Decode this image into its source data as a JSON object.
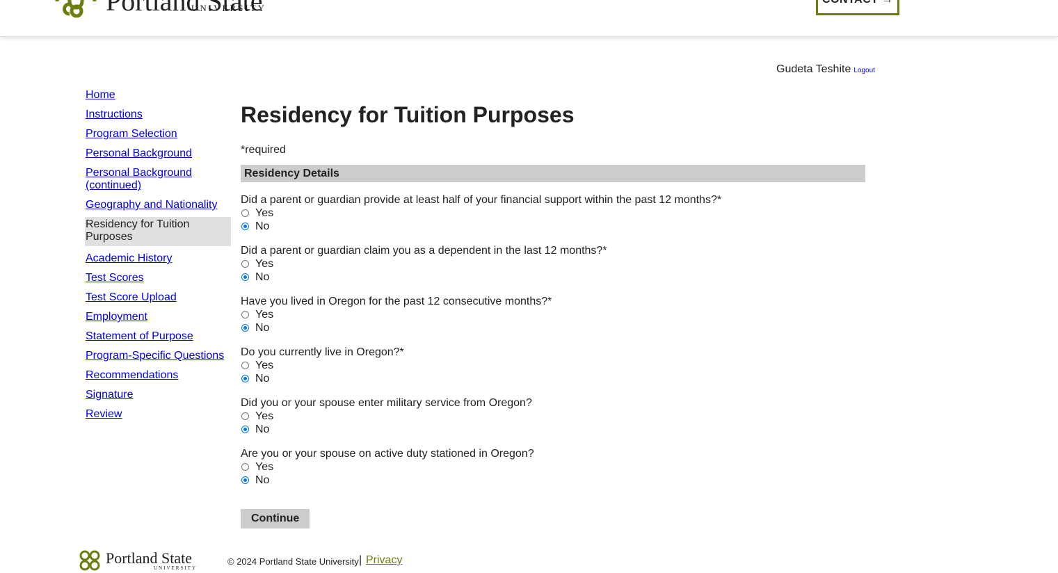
{
  "header": {
    "logo_text": "Portland State",
    "logo_subtext": "UNIVERSITY",
    "contact_label": "CONTACT →"
  },
  "user": {
    "name": "Gudeta Teshite",
    "logout_label": "Logout"
  },
  "sidebar": {
    "items": [
      {
        "label": "Home",
        "current": false
      },
      {
        "label": "Instructions",
        "current": false
      },
      {
        "label": "Program Selection",
        "current": false
      },
      {
        "label": "Personal Background",
        "current": false
      },
      {
        "label": "Personal Background (continued)",
        "current": false
      },
      {
        "label": "Geography and Nationality",
        "current": false
      },
      {
        "label": "Residency for Tuition Purposes",
        "current": true
      },
      {
        "label": "Academic History",
        "current": false
      },
      {
        "label": "Test Scores",
        "current": false
      },
      {
        "label": "Test Score Upload",
        "current": false
      },
      {
        "label": "Employment",
        "current": false
      },
      {
        "label": "Statement of Purpose",
        "current": false
      },
      {
        "label": "Program-Specific Questions",
        "current": false
      },
      {
        "label": "Recommendations",
        "current": false
      },
      {
        "label": "Signature",
        "current": false
      },
      {
        "label": "Review",
        "current": false
      }
    ]
  },
  "main": {
    "title": "Residency for Tuition Purposes",
    "required_note": "*required",
    "section_title": "Residency Details",
    "questions": [
      {
        "text": "Did a parent or guardian provide at least half of your financial support within the past 12 months?*",
        "options": [
          "Yes",
          "No"
        ],
        "selected": "No"
      },
      {
        "text": "Did a parent or guardian claim you as a dependent in the last 12 months?*",
        "options": [
          "Yes",
          "No"
        ],
        "selected": "No"
      },
      {
        "text": "Have you lived in Oregon for the past 12 consecutive months?*",
        "options": [
          "Yes",
          "No"
        ],
        "selected": "No"
      },
      {
        "text": "Do you currently live in Oregon?*",
        "options": [
          "Yes",
          "No"
        ],
        "selected": "No"
      },
      {
        "text": "Did you or your spouse enter military service from Oregon?",
        "options": [
          "Yes",
          "No"
        ],
        "selected": "No"
      },
      {
        "text": "Are you or your spouse on active duty stationed in Oregon?",
        "options": [
          "Yes",
          "No"
        ],
        "selected": "No"
      }
    ],
    "continue_label": "Continue"
  },
  "footer": {
    "logo_text": "Portland State",
    "logo_subtext": "UNIVERSITY",
    "copyright": "© 2024 Portland State University",
    "separator": "|",
    "privacy_label": "Privacy"
  },
  "colors": {
    "brand_green": "#6a7f10",
    "link_blue": "#0000ee",
    "radio_blue": "#0075ff",
    "section_gray": "#cccccc"
  }
}
